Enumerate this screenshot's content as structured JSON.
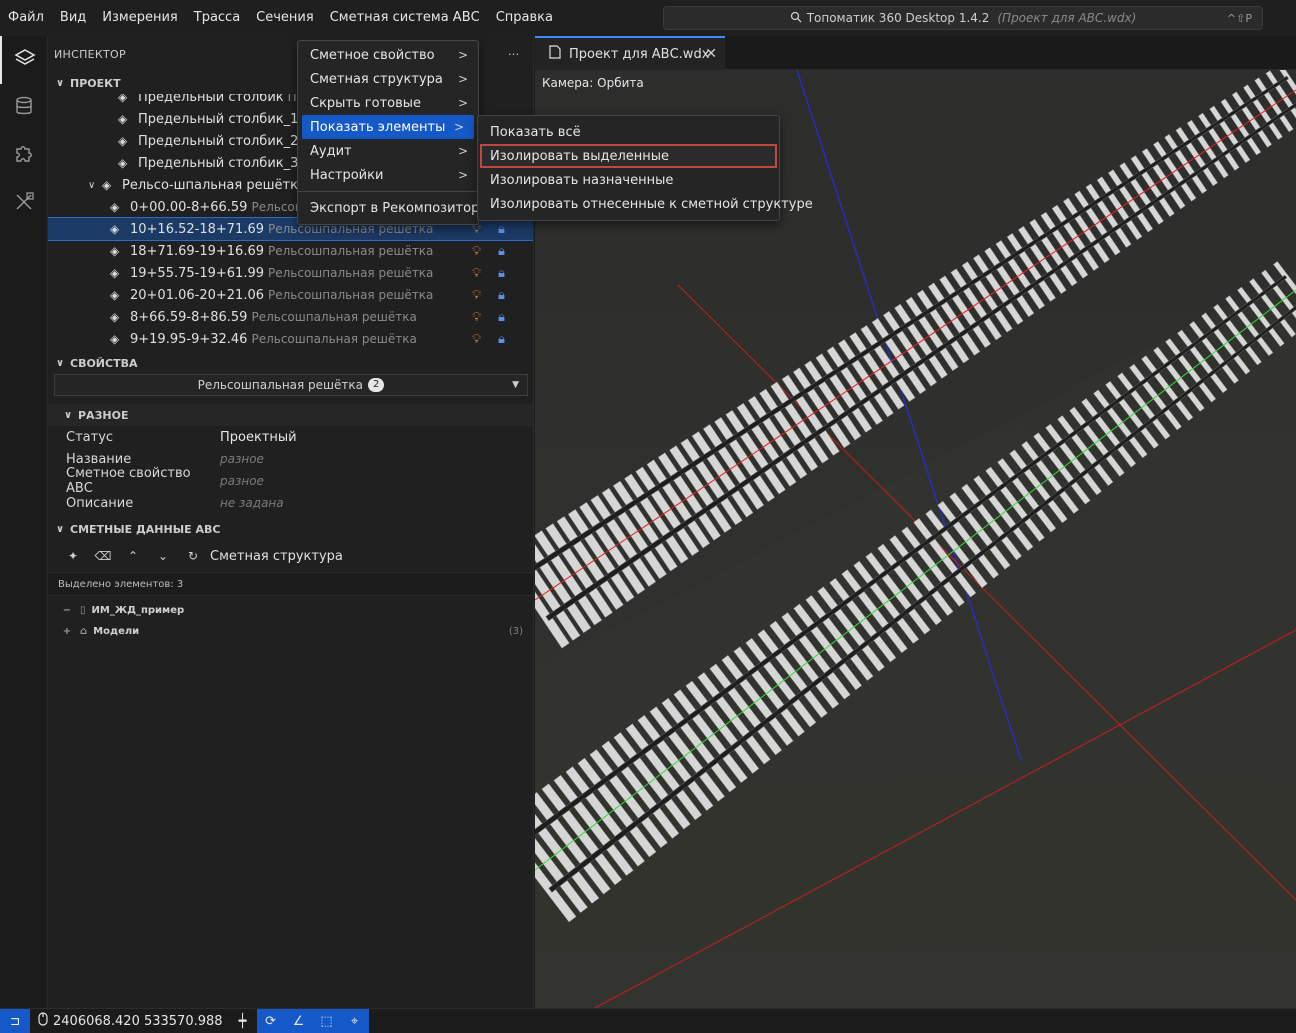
{
  "menubar": {
    "items": [
      "Файл",
      "Вид",
      "Измерения",
      "Трасса",
      "Сечения",
      "Сметная система АВС",
      "Справка"
    ],
    "search": {
      "title": "Топоматик 360 Desktop 1.4.2",
      "subtitle": "(Проект для АВС.wdx)",
      "shortcut": "^⇧P"
    }
  },
  "inspector": {
    "title": "ИНСПЕКТОР",
    "more": "···",
    "project_section": "ПРОЕКТ",
    "tree": [
      {
        "label": "Предельный столбик",
        "sub": "Пр",
        "indent": 70
      },
      {
        "label": "Предельный столбик_1",
        "sub": "Пр",
        "indent": 70
      },
      {
        "label": "Предельный столбик_2",
        "sub": "Пр",
        "indent": 70
      },
      {
        "label": "Предельный столбик_3",
        "sub": "Пр",
        "indent": 70
      },
      {
        "label": "Рельсо-шпальная решётка",
        "sub": "",
        "indent": 54,
        "expanded": true
      },
      {
        "label": "0+00.00-8+66.59",
        "sub": "Рельсошпальная решётка",
        "indent": 62
      },
      {
        "label": "10+16.52-18+71.69",
        "sub": "Рельсошпальная решётка",
        "indent": 62,
        "selected": true
      },
      {
        "label": "18+71.69-19+16.69",
        "sub": "Рельсошпальная решётка",
        "indent": 62
      },
      {
        "label": "19+55.75-19+61.99",
        "sub": "Рельсошпальная решётка",
        "indent": 62
      },
      {
        "label": "20+01.06-20+21.06",
        "sub": "Рельсошпальная решётка",
        "indent": 62
      },
      {
        "label": "8+66.59-8+86.59",
        "sub": "Рельсошпальная решётка",
        "indent": 62
      },
      {
        "label": "9+19.95-9+32.46",
        "sub": "Рельсошпальная решётка",
        "indent": 62
      }
    ]
  },
  "properties": {
    "section": "СВОЙСТВА",
    "type_label": "Рельсошпальная решётка",
    "type_count": "2",
    "group": "РАЗНОЕ",
    "rows": [
      {
        "key": "Статус",
        "value": "Проектный",
        "italic": false
      },
      {
        "key": "Название",
        "value": "разное",
        "italic": true
      },
      {
        "key": "Сметное свойство АВС",
        "value": "разное",
        "italic": true
      },
      {
        "key": "Описание",
        "value": "не задана",
        "italic": true
      }
    ]
  },
  "estimate": {
    "section": "СМЕТНЫЕ ДАННЫЕ АВС",
    "toolbar_label": "Сметная структура",
    "selected_count": "Выделено элементов: 3",
    "tree": [
      {
        "pm": "−",
        "label": "ИМ_ЖД_пример",
        "count": ""
      },
      {
        "pm": "+",
        "label": "Модели",
        "count": "(3)"
      }
    ]
  },
  "editor": {
    "tab_label": "Проект для АВС.wdx",
    "camera_label": "Камера: Орбита"
  },
  "context_menu": {
    "items": [
      {
        "label": "Сметное свойство",
        "submenu": true
      },
      {
        "label": "Сметная структура",
        "submenu": true
      },
      {
        "label": "Скрыть готовые",
        "submenu": true
      },
      {
        "label": "Показать элементы",
        "submenu": true,
        "active": true
      },
      {
        "label": "Аудит",
        "submenu": true
      },
      {
        "label": "Настройки",
        "submenu": true
      },
      {
        "label": "Экспорт в Рекомпозитор",
        "submenu": false
      }
    ]
  },
  "submenu": {
    "items": [
      {
        "label": "Показать всё"
      },
      {
        "label": "Изолировать выделенные",
        "highlighted": true
      },
      {
        "label": "Изолировать назначенные"
      },
      {
        "label": "Изолировать отнесенные к сметной структуре"
      }
    ]
  },
  "statusbar": {
    "coords": "2406068.420 533570.988"
  },
  "colors": {
    "accent": "#1459c7",
    "highlight_border": "#c0463e",
    "bulb": "#e0893a",
    "lock": "#5a8fe6"
  }
}
